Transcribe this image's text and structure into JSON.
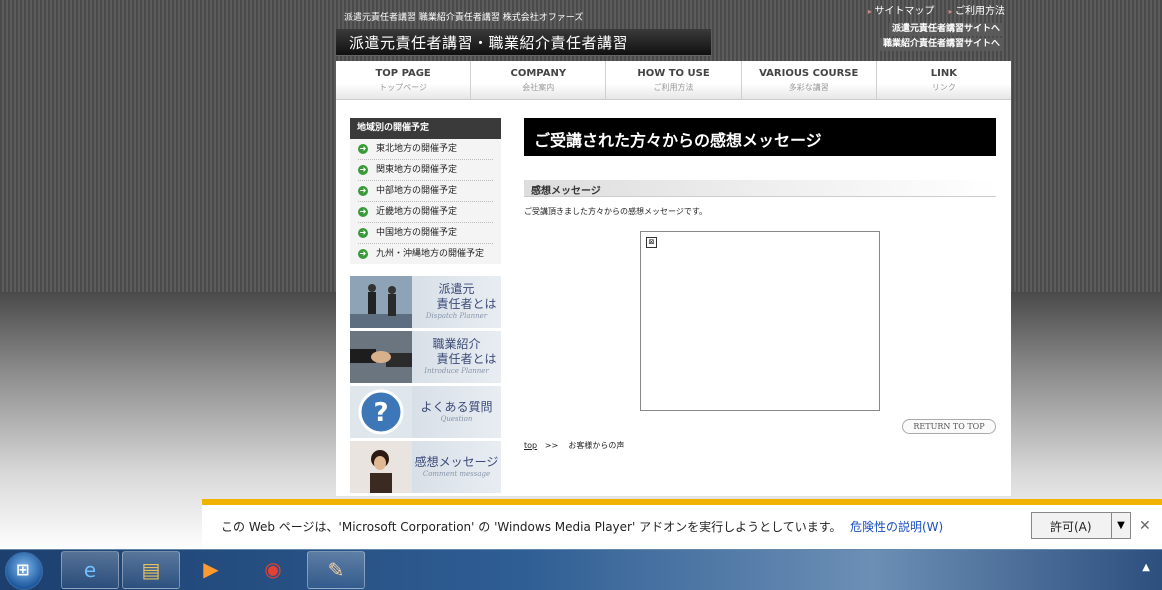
{
  "header": {
    "small_text": "派遣元責任者講習 職業紹介責任者講習 株式会社オファーズ",
    "title": "派遣元責任者講習・職業紹介責任者講習",
    "top_links": [
      "サイトマップ",
      "ご利用方法"
    ],
    "site_buttons": [
      "派遣元責任者講習サイトへ",
      "職業紹介責任者講習サイトへ"
    ]
  },
  "nav": [
    {
      "en": "TOP PAGE",
      "ja": "トップページ"
    },
    {
      "en": "COMPANY",
      "ja": "会社案内"
    },
    {
      "en": "HOW TO USE",
      "ja": "ご利用方法"
    },
    {
      "en": "VARIOUS COURSE",
      "ja": "多彩な講習"
    },
    {
      "en": "LINK",
      "ja": "リンク"
    }
  ],
  "sidebar": {
    "heading": "地域別の開催予定",
    "items": [
      "東北地方の開催予定",
      "関東地方の開催予定",
      "中部地方の開催予定",
      "近畿地方の開催予定",
      "中国地方の開催予定",
      "九州・沖縄地方の開催予定"
    ],
    "banners": [
      {
        "ja1": "派遣元",
        "ja2": "責任者とは",
        "en": "Dispatch Planner"
      },
      {
        "ja1": "職業紹介",
        "ja2": "責任者とは",
        "en": "Introduce Planner"
      },
      {
        "ja1": "よくある質問",
        "ja2": "",
        "en": "Question"
      },
      {
        "ja1": "感想メッセージ",
        "ja2": "",
        "en": "Comment message"
      }
    ]
  },
  "main": {
    "title": "ご受講された方々からの感想メッセージ",
    "section_heading": "感想メッセージ",
    "description": "ご受講頂きました方々からの感想メッセージです。",
    "return_top": "RETURN TO TOP",
    "breadcrumb_link": "top",
    "breadcrumb_sep": ">>",
    "breadcrumb_current": "お客様からの声"
  },
  "ie_bar": {
    "message": "この Web ページは、'Microsoft Corporation' の 'Windows Media Player' アドオンを実行しようとしています。",
    "risk_link": "危険性の説明(W)",
    "allow_button": "許可(A)"
  }
}
